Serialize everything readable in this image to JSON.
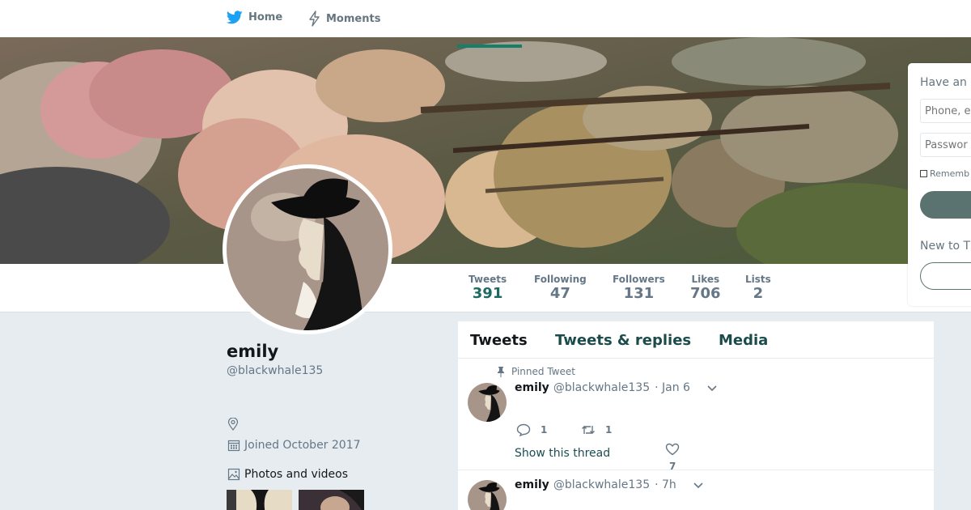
{
  "nav": {
    "home_label": "Home",
    "moments_label": "Moments"
  },
  "profile": {
    "name": "emily",
    "handle": "@blackwhale135",
    "joined": "Joined October 2017",
    "photos_label": "Photos and videos"
  },
  "stats": [
    {
      "label": "Tweets",
      "value": "391"
    },
    {
      "label": "Following",
      "value": "47"
    },
    {
      "label": "Followers",
      "value": "131"
    },
    {
      "label": "Likes",
      "value": "706"
    },
    {
      "label": "Lists",
      "value": "2"
    }
  ],
  "tabs": [
    "Tweets",
    "Tweets & replies",
    "Media"
  ],
  "tweets": [
    {
      "pinned_label": "Pinned Tweet",
      "name": "emily",
      "handle": "@blackwhale135",
      "time": "· Jan 6",
      "replies": "1",
      "retweets": "1",
      "likes": "7",
      "show_thread": "Show this thread"
    },
    {
      "name": "emily",
      "handle": "@blackwhale135",
      "time": "· 7h"
    }
  ],
  "login": {
    "title": "Have an",
    "phone_placeholder": "Phone, e",
    "password_placeholder": "Passwor",
    "remember_label": "Rememb",
    "new_label": "New to T"
  },
  "colors": {
    "accent": "#1c6b61",
    "button": "#5b7370",
    "background": "#e6ecf0",
    "twitter_blue": "#1da1f2"
  }
}
